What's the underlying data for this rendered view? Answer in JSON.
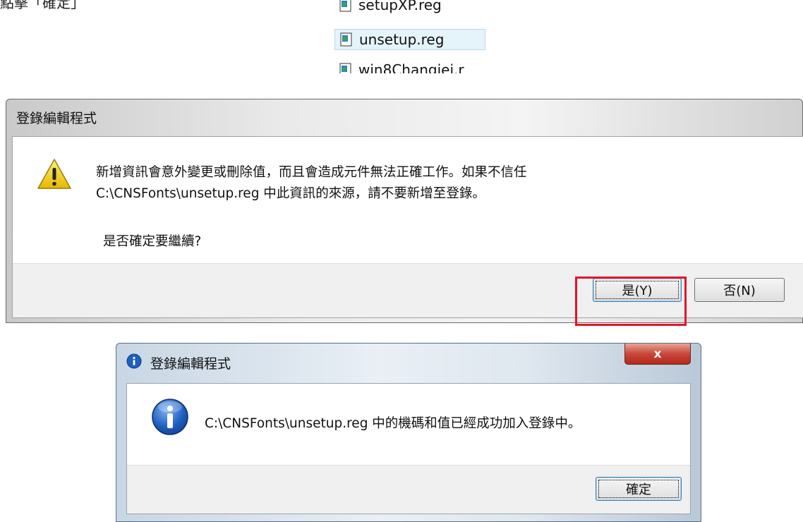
{
  "caption": "點擊「確定」",
  "file_list": {
    "items": [
      {
        "name": "setupXP.reg",
        "selected": false
      },
      {
        "name": "unsetup.reg",
        "selected": true
      },
      {
        "name": "win8Changjei.r",
        "selected": false
      }
    ]
  },
  "confirm_dialog": {
    "title": "登錄編輯程式",
    "message_line1": "新增資訊會意外變更或刪除值，而且會造成元件無法正確工作。如果不信任",
    "message_line2": "C:\\CNSFonts\\unsetup.reg 中此資訊的來源，請不要新增至登錄。",
    "question": "是否確定要繼續?",
    "yes_label": "是(Y)",
    "no_label": "否(N)",
    "icon": "warning-icon",
    "highlight_color": "#e3142b"
  },
  "result_dialog": {
    "title": "登錄編輯程式",
    "close_label": "x",
    "message": "C:\\CNSFonts\\unsetup.reg 中的機碼和值已經成功加入登錄中。",
    "ok_label": "確定",
    "icon": "information-icon"
  }
}
